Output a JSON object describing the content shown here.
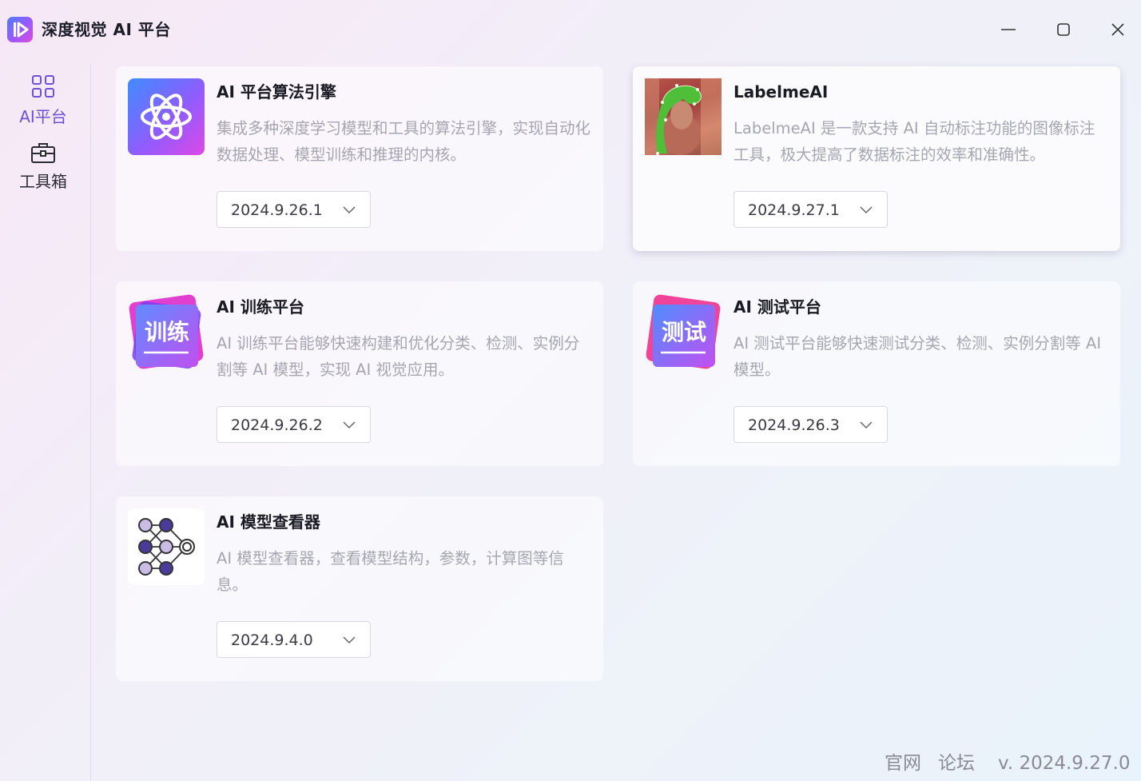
{
  "app": {
    "title": "深度视觉 AI 平台",
    "accent": "#6f51d8"
  },
  "window_controls": {
    "minimize": "minimize-icon",
    "maximize": "maximize-icon",
    "close": "close-icon"
  },
  "sidebar": {
    "items": [
      {
        "label": "AI平台",
        "icon": "grid-icon",
        "active": true
      },
      {
        "label": "工具箱",
        "icon": "toolbox-icon",
        "active": false
      }
    ]
  },
  "cards": [
    {
      "title": "AI 平台算法引擎",
      "description": "集成多种深度学习模型和工具的算法引擎，实现自动化数据处理、模型训练和推理的内核。",
      "version": "2024.9.26.1",
      "icon": "atom-icon"
    },
    {
      "title": "LabelmeAI",
      "description": "LabelmeAI 是一款支持 AI 自动标注功能的图像标注工具，极大提高了数据标注的效率和准确性。",
      "version": "2024.9.27.1",
      "icon": "labelme-image-icon"
    },
    {
      "title": "AI 训练平台",
      "description": "AI 训练平台能够快速构建和优化分类、检测、实例分割等 AI 模型，实现 AI 视觉应用。",
      "version": "2024.9.26.2",
      "icon": "train-badge-icon",
      "badge": "训练"
    },
    {
      "title": "AI 测试平台",
      "description": "AI 测试平台能够快速测试分类、检测、实例分割等 AI 模型。",
      "version": "2024.9.26.3",
      "icon": "test-badge-icon",
      "badge": "测试"
    },
    {
      "title": "AI 模型查看器",
      "description": "AI 模型查看器，查看模型结构，参数，计算图等信息。",
      "version": "2024.9.4.0",
      "icon": "neural-network-icon"
    }
  ],
  "footer": {
    "website": "官网",
    "forum": "论坛",
    "version": "v. 2024.9.27.0"
  }
}
